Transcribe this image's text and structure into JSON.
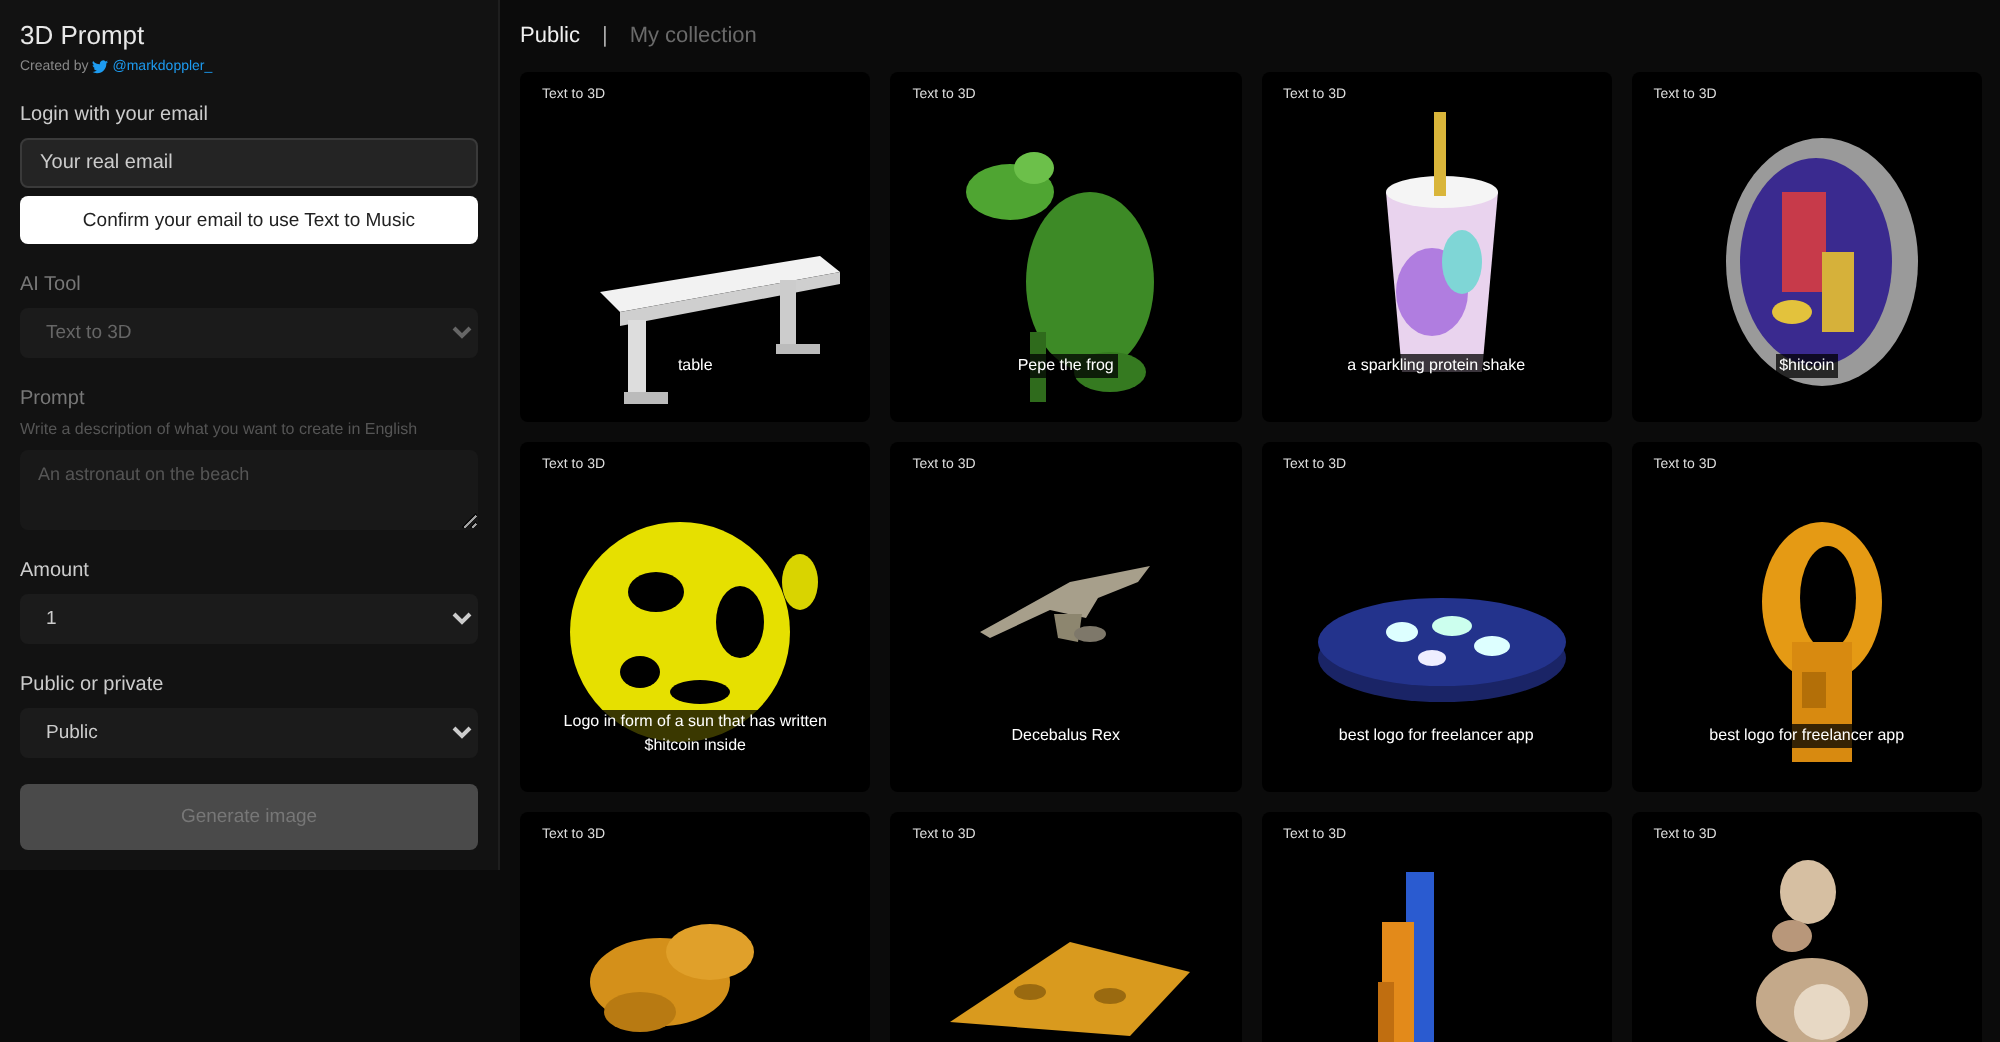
{
  "app": {
    "title": "3D Prompt",
    "credit": "Created by",
    "handle": "@markdoppler_"
  },
  "login": {
    "label": "Login with your email",
    "email": {
      "placeholder": "Your real email"
    },
    "confirm_button": "Confirm your email to use Text to Music"
  },
  "fields": [
    {
      "kind": "select",
      "label": "AI Tool",
      "value": "Text to 3D",
      "disabled": true
    },
    {
      "kind": "textarea",
      "label": "Prompt",
      "hint": "Write a description of what you want to create in English",
      "placeholder": "An astronaut on the beach",
      "disabled": true
    },
    {
      "kind": "select",
      "label": "Amount",
      "value": "1",
      "disabled": false
    },
    {
      "kind": "select",
      "label": "Public or private",
      "value": "Public",
      "disabled": false
    }
  ],
  "generate_button": {
    "label": "Generate image",
    "disabled": true
  },
  "tabs": [
    {
      "label": "Public",
      "selected": true
    },
    {
      "label": "My collection",
      "selected": false
    }
  ],
  "tab_separator": "|",
  "cards": [
    {
      "tag": "Text to 3D",
      "caption": "table",
      "kind": "picture"
    },
    {
      "tag": "Text to 3D",
      "caption": "Pepe the frog",
      "kind": "picture"
    },
    {
      "tag": "Text to 3D",
      "caption": "a sparkling protein shake",
      "kind": "picture"
    },
    {
      "tag": "Text to 3D",
      "caption": "$hitcoin",
      "kind": "picture"
    },
    {
      "tag": "Text to 3D",
      "caption": "Logo in form of a sun that has written $hitcoin inside",
      "kind": "picture"
    },
    {
      "tag": "Text to 3D",
      "caption": "Decebalus Rex",
      "kind": "picture"
    },
    {
      "tag": "Text to 3D",
      "caption": "best logo for freelancer app",
      "kind": "picture"
    },
    {
      "tag": "Text to 3D",
      "caption": "best logo for freelancer app",
      "kind": "picture"
    },
    {
      "tag": "Text to 3D",
      "kind": "picture"
    },
    {
      "tag": "Text to 3D",
      "kind": "picture"
    },
    {
      "tag": "Text to 3D",
      "kind": "picture"
    },
    {
      "tag": "Text to 3D",
      "kind": "picture"
    }
  ]
}
